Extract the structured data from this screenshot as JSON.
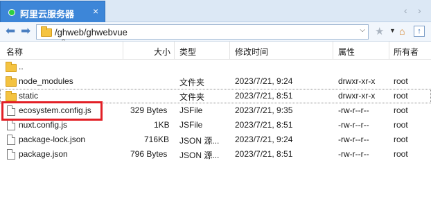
{
  "tab": {
    "title": "阿里云服务器",
    "close": "×"
  },
  "tab_nav": {
    "prev": "‹",
    "next": "›"
  },
  "address": {
    "path": "/ghweb/ghwebvue"
  },
  "columns": {
    "name": "名称",
    "size": "大小",
    "type": "类型",
    "modified": "修改时间",
    "attrs": "属性",
    "owner": "所有者"
  },
  "files": [
    {
      "icon": "folder-icon",
      "name": "..",
      "size": "",
      "type": "",
      "modified": "",
      "attrs": "",
      "owner": ""
    },
    {
      "icon": "folder-icon",
      "name": "node_modules",
      "size": "",
      "type": "文件夹",
      "modified": "2023/7/21, 9:24",
      "attrs": "drwxr-xr-x",
      "owner": "root"
    },
    {
      "icon": "folder-icon",
      "name": "static",
      "size": "",
      "type": "文件夹",
      "modified": "2023/7/21, 8:51",
      "attrs": "drwxr-xr-x",
      "owner": "root"
    },
    {
      "icon": "file-icon",
      "name": "ecosystem.config.js",
      "size": "329 Bytes",
      "type": "JSFile",
      "modified": "2023/7/21, 9:35",
      "attrs": "-rw-r--r--",
      "owner": "root"
    },
    {
      "icon": "file-icon",
      "name": "nuxt.config.js",
      "size": "1KB",
      "type": "JSFile",
      "modified": "2023/7/21, 8:51",
      "attrs": "-rw-r--r--",
      "owner": "root"
    },
    {
      "icon": "file-icon",
      "name": "package-lock.json",
      "size": "716KB",
      "type": "JSON 源...",
      "modified": "2023/7/21, 9:24",
      "attrs": "-rw-r--r--",
      "owner": "root"
    },
    {
      "icon": "file-icon",
      "name": "package.json",
      "size": "796 Bytes",
      "type": "JSON 源...",
      "modified": "2023/7/21, 8:51",
      "attrs": "-rw-r--r--",
      "owner": "root"
    }
  ],
  "colors": {
    "tab_active": "#3d86d8",
    "highlight": "#e21f26",
    "folder": "#f4c341"
  }
}
